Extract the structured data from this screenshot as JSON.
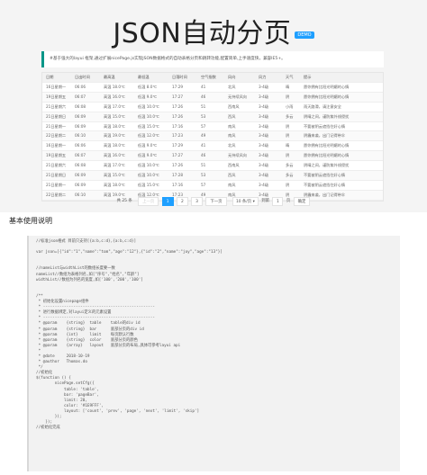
{
  "header": {
    "title": "JSON自动分页",
    "badge": "DEMO"
  },
  "notice": "#基于强大的layui 框架,通过扩展nicePage.js实现JSON数据格式的自动表格分页和跳转功能,配置简单,上手速度快，兼容IE5+。",
  "table": {
    "columns": [
      "日期",
      "日出时间",
      "最高温",
      "最低温",
      "日落时间",
      "空气指数",
      "风向",
      "风力",
      "天气",
      "提示"
    ],
    "rows": [
      [
        "16日星期一",
        "06:06",
        "高温 18.0℃",
        "低温 8.0℃",
        "17:29",
        "41",
        "北风",
        "3-4级",
        "晴",
        "愿你拥有比阳光明媚的心情"
      ],
      [
        "19日星期五",
        "06:07",
        "高温 16.0℃",
        "低温 9.0℃",
        "17:27",
        "46",
        "无持续风向",
        "3-4级",
        "阴",
        "愿你拥有比阳光明媚的心情"
      ],
      [
        "21日星期六",
        "06:08",
        "高温 17.0℃",
        "低温 10.0℃",
        "17:26",
        "51",
        "西南风",
        "3-4级",
        "小雨",
        "雨天路滑，请注意安全"
      ],
      [
        "21日星期日",
        "06:09",
        "高温 15.0℃",
        "低温 10.0℃",
        "17:26",
        "53",
        "西风",
        "3-4级",
        "多云",
        "阴晴之间，谨防紫外线侵扰"
      ],
      [
        "21日星期一",
        "06:09",
        "高温 18.0℃",
        "低温 15.0℃",
        "17:16",
        "57",
        "南风",
        "3-4级",
        "阴",
        "不要被阴云遮挡住好心情"
      ],
      [
        "22日星期二",
        "06:10",
        "高温 19.0℃",
        "低温 12.0℃",
        "17:23",
        "49",
        "南风",
        "3-4级",
        "阴",
        "阴霾来袭，出门记得带伞"
      ],
      [
        "16日星期一",
        "06:06",
        "高温 18.0℃",
        "低温 9.0℃",
        "17:29",
        "41",
        "北风",
        "3-4级",
        "晴",
        "愿你拥有比阳光明媚的心情"
      ],
      [
        "19日星期五",
        "06:07",
        "高温 16.0℃",
        "低温 9.0℃",
        "17:27",
        "46",
        "无持续风向",
        "3-4级",
        "阴",
        "愿你拥有比阳光明媚的心情"
      ],
      [
        "21日星期六",
        "06:08",
        "高温 17.0℃",
        "低温 10.0℃",
        "17:26",
        "51",
        "西南风",
        "3-4级",
        "多云",
        "阴晴之间，谨防紫外线侵扰"
      ],
      [
        "21日星期日",
        "06:09",
        "高温 15.0℃",
        "低温 10.0℃",
        "17:28",
        "53",
        "西风",
        "3-4级",
        "多云",
        "不要被阴云遮挡住好心情"
      ],
      [
        "21日星期一",
        "06:09",
        "高温 18.0℃",
        "低温 15.0℃",
        "17:16",
        "57",
        "南风",
        "3-4级",
        "阴",
        "不要被阴云遮挡住好心情"
      ],
      [
        "22日星期二",
        "06:10",
        "高温 19.0℃",
        "低温 12.0℃",
        "17:23",
        "49",
        "南风",
        "3-4级",
        "阴",
        "阴霾来袭，出门记得带伞"
      ]
    ]
  },
  "pager": {
    "count": "共 25 条",
    "prev": "上一页",
    "pages": [
      "1",
      "2",
      "3"
    ],
    "next": "下一页",
    "limit": "10 条/页",
    "skip_prefix": "到第",
    "skip_value": "1",
    "skip_suffix": "页",
    "go": "确定"
  },
  "section_title": "基本使用说明",
  "code_lines": [
    "//标准json格式 目前只支持[{a:b,c:d},{a:b,c:d}]",
    "",
    "var json=[{\"id\":\"1\",\"name\":\"tom\",\"age\":\"12\"},{\"id\":\"2\",\"name\":\"joy\",\"age\":\"13\"}]",
    "",
    "",
    "//nameList与widthList的数组长度要一致",
    "nameList//数组为表格列名,如[\"序号\",\"姓名\",\"年龄\"]",
    "widthList//数组为列名的宽度,如['100','200','100']",
    "",
    "",
    "/**",
    " * 初始化设置nicepage组件",
    " * ------------------------------------------------",
    " * 进行数据绑定,对layui定义的元素设置",
    " * ------------------------------------------------",
    " * @param    {string}  table    table的div id",
    " * @param    {string}  bar      底部分页的div id",
    " * @param    {int}     limit    每页默认行数",
    " * @param    {string}  color    底部分页的颜色",
    " * @param    {array}   layout   底部分页的布局,具体可参考layui api",
    " *",
    " * @date     2018-10-19",
    " * @author   Thomas.do",
    " */",
    "//初始化",
    "$(function () {",
    "        nicePage.setCfg({",
    "            table: 'table',",
    "            bar: 'pageBar',",
    "            limit: 20,",
    "            color: '#1E9FFF',",
    "            layout: ['count', 'prev', 'page', 'next', 'limit', 'skip']",
    "        });",
    "    });",
    "//初始化完成"
  ]
}
